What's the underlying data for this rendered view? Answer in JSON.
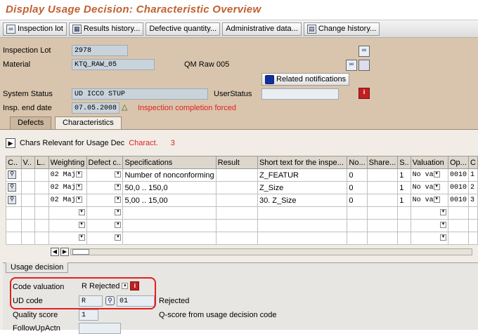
{
  "window": {
    "title": "Display Usage Decision: Characteristic Overview"
  },
  "toolbar": [
    {
      "label": "Inspection lot",
      "icon": "glasses-icon"
    },
    {
      "label": "Results history...",
      "icon": "history-icon"
    },
    {
      "label": "Defective quantity...",
      "icon": ""
    },
    {
      "label": "Administrative data...",
      "icon": ""
    },
    {
      "label": "Change history...",
      "icon": "document-icon"
    }
  ],
  "header": {
    "inspection_lot_label": "Inspection Lot",
    "inspection_lot": "2978",
    "material_label": "Material",
    "material": "KTQ_RAW_05",
    "material_desc": "QM Raw 005",
    "related_notifications": "Related notifications",
    "system_status_label": "System Status",
    "system_status": "UD   ICCO STUP",
    "user_status_label": "UserStatus",
    "user_status": "",
    "insp_end_label": "Insp. end date",
    "insp_end": "07.05.2008",
    "completion_msg": "Inspection completion forced"
  },
  "tabs": [
    "Defects",
    "Characteristics"
  ],
  "chars": {
    "relevant_label": "Chars Relevant for Usage Dec",
    "charact_label": "Charact.",
    "charact_count": "3",
    "columns": [
      "C..",
      "V..",
      "L..",
      "Weighting",
      "Defect c..",
      "Specifications",
      "Result",
      "Short text for the inspe...",
      "No...",
      "Share...",
      "S..",
      "Valuation",
      "Op...",
      "C"
    ],
    "rows": [
      {
        "weighting": "02 Maj",
        "spec": "Number of nonconforming",
        "result": "",
        "short": "Z_FEATUR",
        "no": "0",
        "s": "1",
        "valuation": "No va",
        "op": "0010",
        "c": "1"
      },
      {
        "weighting": "02 Maj",
        "spec": "50,0 .. 150,0",
        "result": "",
        "short": "Z_Size",
        "no": "0",
        "s": "1",
        "valuation": "No va",
        "op": "0010",
        "c": "2"
      },
      {
        "weighting": "02 Maj",
        "spec": "5,00 .. 15,00",
        "result": "",
        "short": "30. Z_Size",
        "no": "0",
        "s": "1",
        "valuation": "No va",
        "op": "0010",
        "c": "3"
      }
    ]
  },
  "usage_decision": {
    "title": "Usage decision",
    "code_valuation_label": "Code valuation",
    "code_valuation": "R Rejected",
    "ud_code_label": "UD code",
    "ud_code": "R",
    "ud_code_num": "01",
    "ud_code_text": "Rejected",
    "quality_score_label": "Quality score",
    "quality_score": "1",
    "qscore_text": "Q-score from usage decision code",
    "follow_up_label": "FollowUpActn"
  },
  "colors": {
    "header_bg": "#d9c5ad",
    "accent_red": "#e02020",
    "title": "#c06030"
  }
}
